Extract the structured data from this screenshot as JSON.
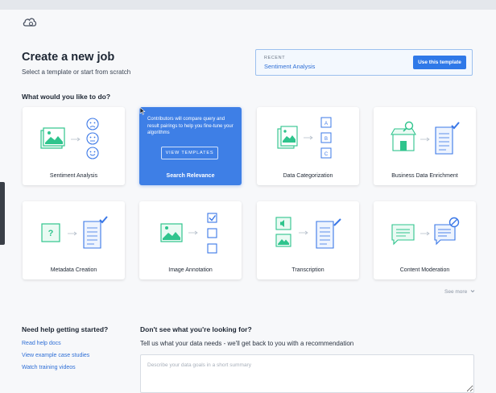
{
  "header": {
    "title": "Create a new job",
    "subtitle": "Select a template or start from scratch"
  },
  "recent": {
    "label": "RECENT",
    "value": "Sentiment Analysis",
    "button_label": "Use this template"
  },
  "question": "What would you like to do?",
  "templates": [
    {
      "label": "Sentiment Analysis"
    },
    {
      "label": "Search Relevance",
      "description": "Contributors will compare query and result pairings to help you fine-tune your algorithms",
      "button_label": "VIEW TEMPLATES"
    },
    {
      "label": "Data Categorization",
      "tiles": [
        "A",
        "B",
        "C"
      ]
    },
    {
      "label": "Business Data Enrichment"
    },
    {
      "label": "Metadata Creation",
      "glyph": "?"
    },
    {
      "label": "Image Annotation"
    },
    {
      "label": "Transcription"
    },
    {
      "label": "Content Moderation"
    }
  ],
  "see_more": "See more",
  "help": {
    "title": "Need help getting started?",
    "links": [
      "Read help docs",
      "View example case studies",
      "Watch training videos"
    ]
  },
  "recommend": {
    "title": "Don't see what you're looking for?",
    "subtitle": "Tell us what your data needs - we'll get back to you with a recommendation",
    "placeholder": "Describe your data goals in a short summary"
  },
  "colors": {
    "accent": "#2f79e8",
    "green": "#2fc48d",
    "blue": "#3b78e7"
  },
  "icons": {
    "logo": "cloud-logo-icon",
    "cursor": "cursor-icon",
    "see_more": "chevron-down-icon"
  }
}
